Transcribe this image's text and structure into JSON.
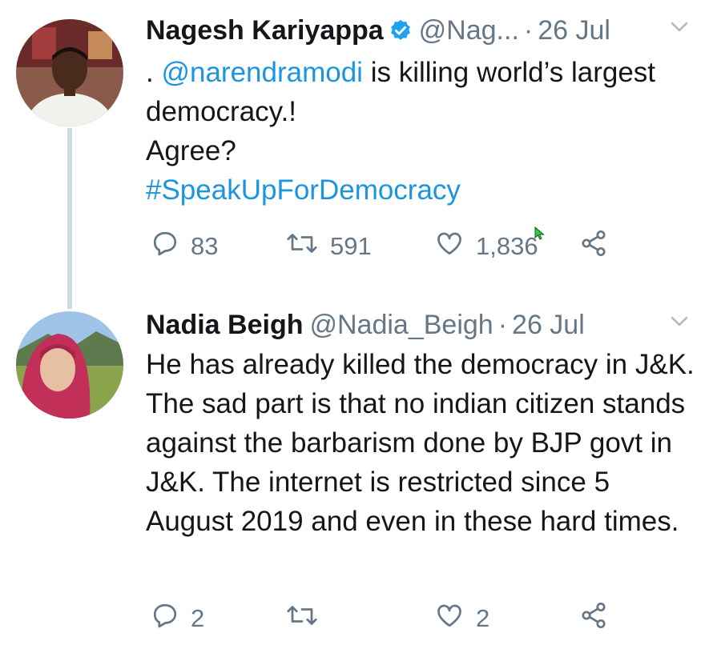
{
  "tweets": [
    {
      "name": "Nagesh Kariyappa",
      "handle": "@Nag...",
      "sep": "·",
      "time": "26 Jul",
      "verified": true,
      "text_parts": [
        ".",
        "@narendramodi",
        "is killing world’s largest democracy.!"
      ],
      "line2": "Agree?",
      "hashtag": "#SpeakUpForDemocracy",
      "replies": "83",
      "retweets": "591",
      "likes": "1,836"
    },
    {
      "name": "Nadia Beigh",
      "handle": "@Nadia_Beigh",
      "sep": "·",
      "time": "26 Jul",
      "text": "He has already killed the democracy in J&K. The sad part is that no indian citizen stands against the barbarism done by BJP govt in J&K. The internet is restricted since 5 August 2019 and even in these hard times.",
      "replies": "2",
      "retweets": "",
      "likes": "2"
    }
  ],
  "colors": {
    "link": "#1b95e0",
    "muted": "#657786",
    "text": "#14171a",
    "verified": "#1da1f2",
    "thread_line": "#cfd9de"
  },
  "icons": [
    "verified-badge-icon",
    "chevron-down-icon",
    "reply-icon",
    "retweet-icon",
    "like-icon",
    "share-icon",
    "mouse-cursor-icon"
  ]
}
